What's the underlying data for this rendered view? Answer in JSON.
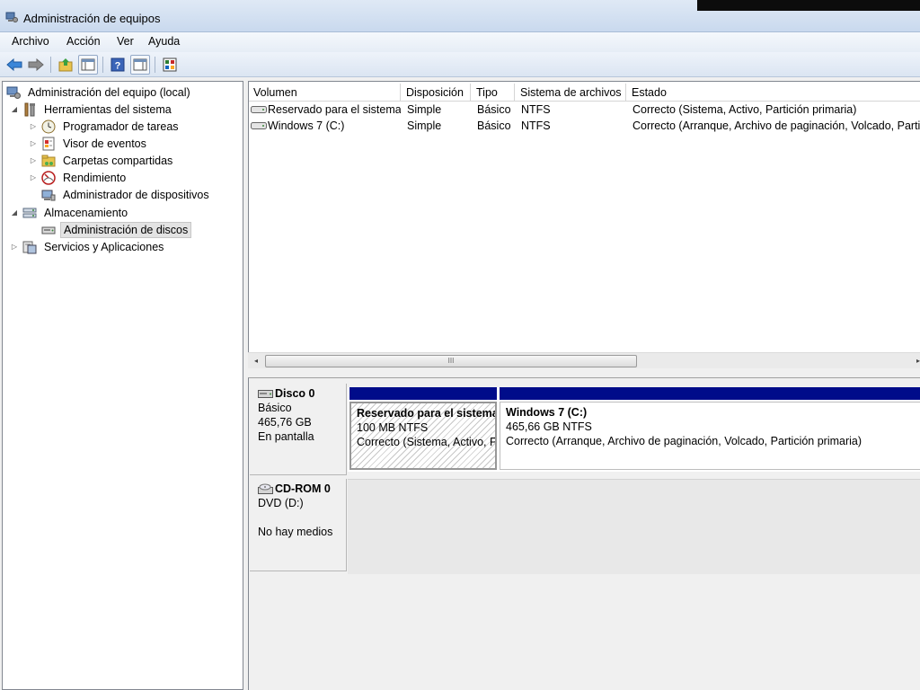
{
  "window": {
    "title": "Administración de equipos"
  },
  "menu": [
    "Archivo",
    "Acción",
    "Ver",
    "Ayuda"
  ],
  "toolbar": {
    "buttons": [
      {
        "name": "back-arrow-icon"
      },
      {
        "name": "forward-arrow-icon"
      },
      {
        "name": "up-folder-icon"
      },
      {
        "name": "show-hide-tree-icon"
      },
      {
        "name": "help-icon"
      },
      {
        "name": "show-hide-action-pane-icon"
      },
      {
        "name": "properties-icon"
      }
    ]
  },
  "tree": {
    "items": [
      {
        "label": "Administración del equipo (local)",
        "icon": "computer-icon",
        "level": 0,
        "expander": "none"
      },
      {
        "label": "Herramientas del sistema",
        "icon": "tools-icon",
        "level": 1,
        "expander": "expanded"
      },
      {
        "label": "Programador de tareas",
        "icon": "clock-icon",
        "level": 2,
        "expander": "collapsed"
      },
      {
        "label": "Visor de eventos",
        "icon": "event-viewer-icon",
        "level": 2,
        "expander": "collapsed"
      },
      {
        "label": "Carpetas compartidas",
        "icon": "shared-folder-icon",
        "level": 2,
        "expander": "collapsed"
      },
      {
        "label": "Rendimiento",
        "icon": "performance-icon",
        "level": 2,
        "expander": "collapsed"
      },
      {
        "label": "Administrador de dispositivos",
        "icon": "device-manager-icon",
        "level": 2,
        "expander": "none"
      },
      {
        "label": "Almacenamiento",
        "icon": "storage-icon",
        "level": 1,
        "expander": "expanded"
      },
      {
        "label": "Administración de discos",
        "icon": "disk-management-icon",
        "level": 2,
        "expander": "none",
        "selected": true
      },
      {
        "label": "Servicios y Aplicaciones",
        "icon": "services-icon",
        "level": 1,
        "expander": "collapsed"
      }
    ]
  },
  "volumes": {
    "columns": [
      "Volumen",
      "Disposición",
      "Tipo",
      "Sistema de archivos",
      "Estado"
    ],
    "rows": [
      [
        "Reservado para el sistema",
        "Simple",
        "Básico",
        "NTFS",
        "Correcto (Sistema, Activo, Partición primaria)"
      ],
      [
        "Windows 7 (C:)",
        "Simple",
        "Básico",
        "NTFS",
        "Correcto (Arranque, Archivo de paginación, Volcado, Partición primaria)"
      ]
    ],
    "scrollbar_grip": "III"
  },
  "disks": [
    {
      "name": "Disco 0",
      "type": "Básico",
      "size": "465,76 GB",
      "status": "En pantalla",
      "partitions": [
        {
          "name": "Reservado para el sistema",
          "size": "100 MB NTFS",
          "status": "Correcto (Sistema, Activo, Partición primaria)"
        },
        {
          "name": "Windows 7  (C:)",
          "size": "465,66 GB NTFS",
          "status": "Correcto (Arranque, Archivo de paginación, Volcado, Partición primaria)"
        }
      ]
    },
    {
      "name": "CD-ROM 0",
      "type": "DVD (D:)",
      "status": "No hay medios"
    }
  ],
  "colors": {
    "partition_bar": "#000c8a",
    "titlebar": "#c9d9ee"
  }
}
